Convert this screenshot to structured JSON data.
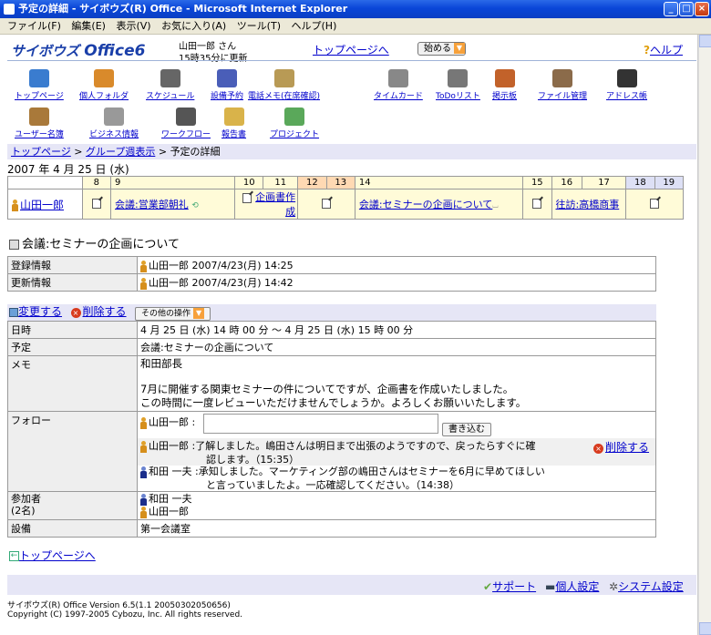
{
  "window": {
    "title": "予定の詳細 - サイボウズ(R) Office - Microsoft Internet Explorer"
  },
  "menu": [
    "ファイル(F)",
    "編集(E)",
    "表示(V)",
    "お気に入り(A)",
    "ツール(T)",
    "ヘルプ(H)"
  ],
  "header": {
    "logo_prefix": "サイボウズ",
    "logo_main": "Office6",
    "user": "山田一郎 さん",
    "updated": "15時35分に更新",
    "top_link": "トップページへ",
    "start_btn": "始める",
    "help": "ヘルプ"
  },
  "apps_row1": [
    {
      "label": "トップページ",
      "icon": "top-page-icon",
      "color": "#3a7ccf"
    },
    {
      "label": "個人フォルダ",
      "icon": "personal-folder-icon",
      "color": "#d98a2b"
    },
    {
      "label": "スケジュール",
      "icon": "schedule-icon",
      "color": "#666666"
    },
    {
      "label": "設備予約",
      "icon": "facility-icon",
      "color": "#4a5eb8"
    },
    {
      "label": "電話メモ(在席確認)",
      "icon": "phone-memo-icon",
      "color": "#b89a55"
    },
    {
      "label": "タイムカード",
      "icon": "timecard-icon",
      "color": "#888888"
    },
    {
      "label": "ToDoリスト",
      "icon": "todo-icon",
      "color": "#777777"
    },
    {
      "label": "掲示板",
      "icon": "bulletin-icon",
      "color": "#c2622a"
    },
    {
      "label": "ファイル管理",
      "icon": "file-manage-icon",
      "color": "#8b6b4a"
    },
    {
      "label": "アドレス帳",
      "icon": "address-book-icon",
      "color": "#333333"
    }
  ],
  "apps_row2": [
    {
      "label": "ユーザー名簿",
      "icon": "user-list-icon",
      "color": "#a9793a"
    },
    {
      "label": "ビジネス情報",
      "icon": "business-info-icon",
      "color": "#999999"
    },
    {
      "label": "ワークフロー",
      "icon": "workflow-icon",
      "color": "#555555"
    },
    {
      "label": "報告書",
      "icon": "report-icon",
      "color": "#d9b34a"
    },
    {
      "label": "プロジェクト",
      "icon": "project-icon",
      "color": "#5aa85a"
    }
  ],
  "breadcrumb": {
    "a": "トップページ",
    "b": "グループ週表示",
    "c": "予定の詳細"
  },
  "date": "2007 年 4 月 25 日 (水)",
  "hours": [
    "8",
    "9",
    "10",
    "11",
    "12",
    "13",
    "14",
    "15",
    "16",
    "17",
    "18",
    "19"
  ],
  "member": "山田一郎",
  "events": {
    "e1": "会議:営業部朝礼",
    "e2": "企画書作成",
    "e3": "会議:セミナーの企画について",
    "e4": "往訪:高橋商事"
  },
  "subject": "会議:セミナーの企画について",
  "reg": {
    "label1": "登録情報",
    "val1": "山田一郎 2007/4/23(月) 14:25",
    "label2": "更新情報",
    "val2": "山田一郎 2007/4/23(月) 14:42"
  },
  "actions": {
    "edit": "変更する",
    "del": "削除する",
    "other": "その他の操作"
  },
  "detail": {
    "date_label": "日時",
    "date_val": "4 月 25 日 (水) 14 時 00 分 〜 4 月 25 日 (水) 15 時 00 分",
    "plan_label": "予定",
    "plan_val": "会議:セミナーの企画について",
    "memo_label": "メモ",
    "memo1": "和田部長",
    "memo2": "7月に開催する関東セミナーの件についてですが、企画書を作成いたしました。",
    "memo3": "この時間に一度レビューいただけませんでしょうか。よろしくお願いいたします。",
    "follow_label": "フォロー",
    "follow_user": "山田一郎 :",
    "write_btn": "書き込む",
    "f1_name": "山田一郎 :",
    "f1_text1": "了解しました。嶋田さんは明日まで出張のようですので、戻ったらすぐに確",
    "f1_text2": "認します。（15:35）",
    "f1_del": "削除する",
    "f2_name": "和田 一夫 :",
    "f2_text1": "承知しました。マーケティング部の嶋田さんはセミナーを6月に早めてほしい",
    "f2_text2": "と言っていましたよ。一応確認してください。（14:38）",
    "part_label1": "参加者",
    "part_label2": "(2名)",
    "part1": "和田 一夫",
    "part2": "山田一郎",
    "fac_label": "設備",
    "fac_val": "第一会議室"
  },
  "back": "トップページへ",
  "footer": {
    "support": "サポート",
    "personal": "個人設定",
    "system": "システム設定"
  },
  "version": "サイボウズ(R) Office Version 6.5(1.1 20050302050656)",
  "copyright": "Copyright (C) 1997-2005 Cybozu, Inc. All rights reserved."
}
